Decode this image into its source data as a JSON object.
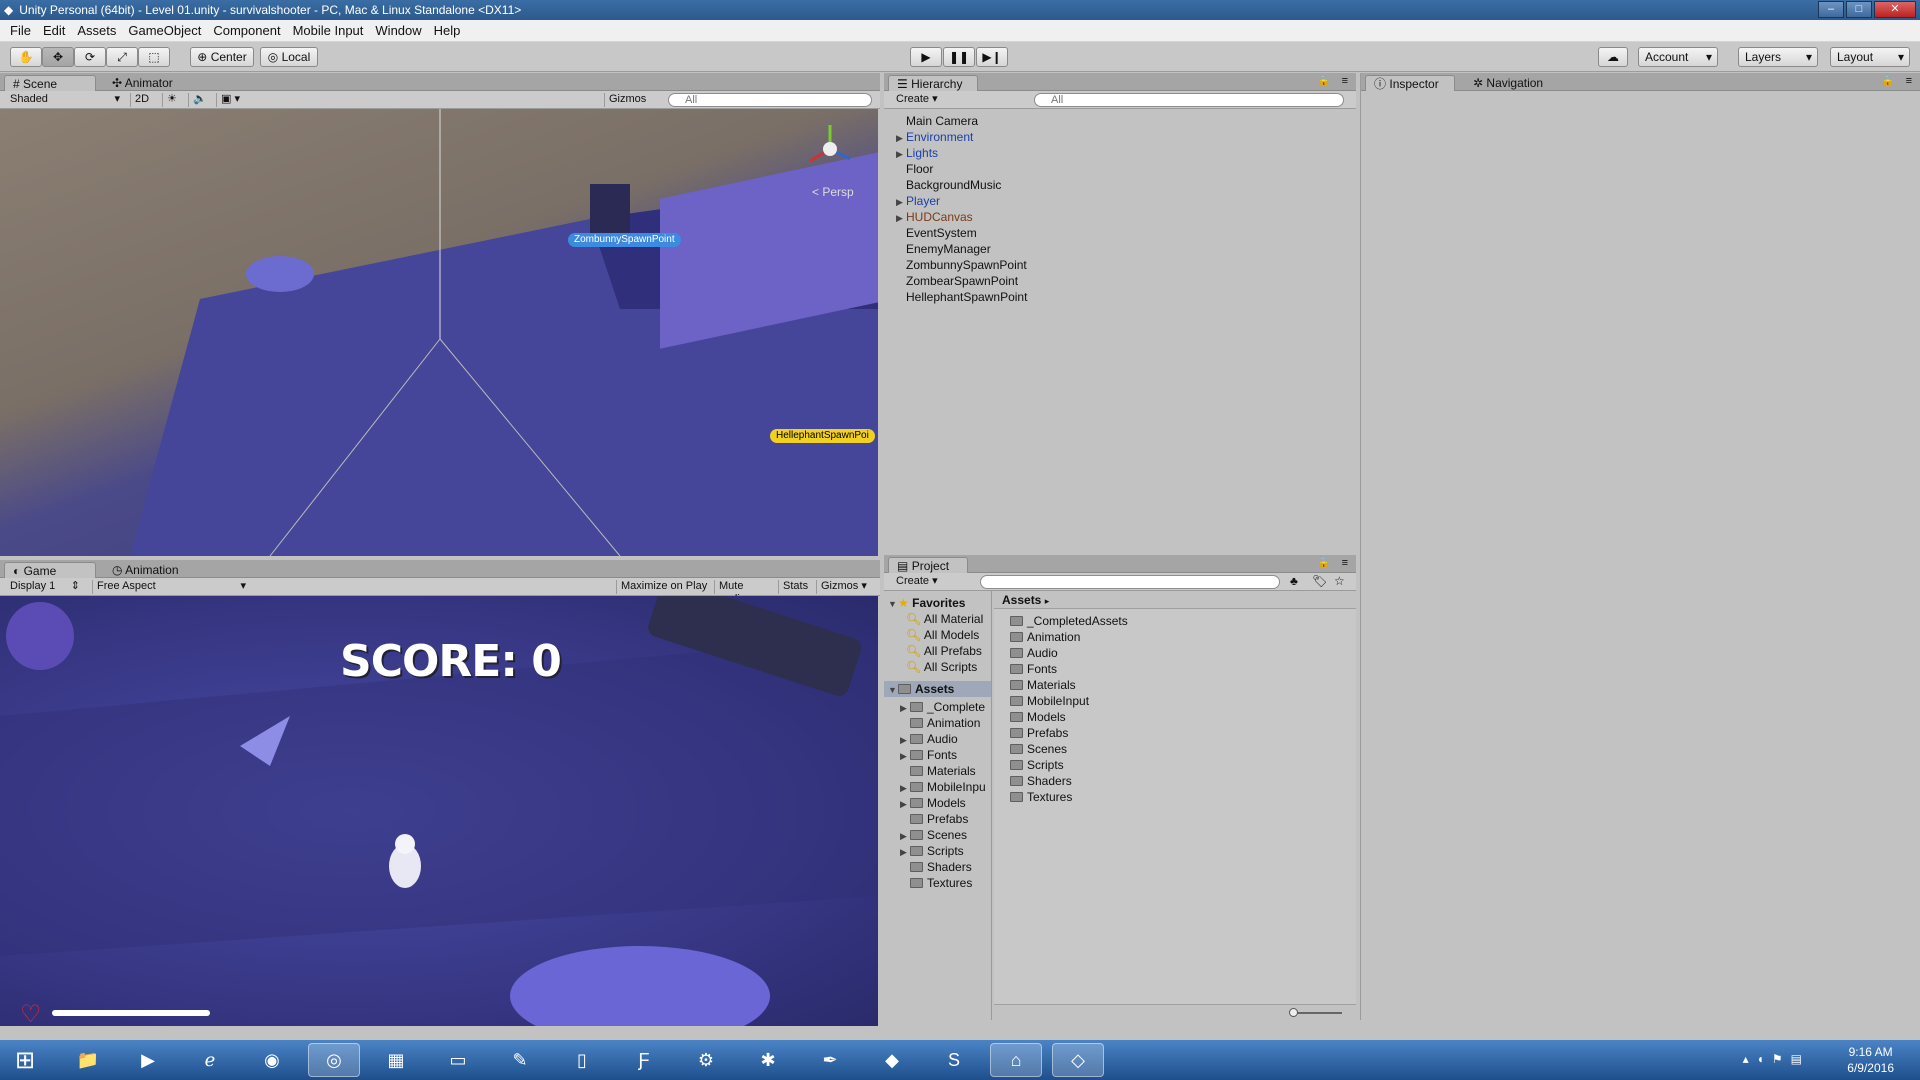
{
  "window": {
    "title": "Unity Personal (64bit) - Level 01.unity - survivalshooter - PC, Mac & Linux Standalone <DX11>"
  },
  "menu": [
    "File",
    "Edit",
    "Assets",
    "GameObject",
    "Component",
    "Mobile Input",
    "Window",
    "Help"
  ],
  "toolbar": {
    "pivot_label": "Center",
    "space_label": "Local",
    "account_label": "Account",
    "layers_label": "Layers",
    "layout_label": "Layout"
  },
  "scene": {
    "tab_label": "Scene",
    "animator_tab": "Animator",
    "shading_mode": "Shaded",
    "mode_2d": "2D",
    "gizmos_label": "Gizmos",
    "search_placeholder": "All",
    "persp_label": "Persp",
    "spawn_label_1": "ZombunnySpawnPoint",
    "spawn_label_2": "HellephantSpawnPoi"
  },
  "game": {
    "tab_label": "Game",
    "animation_tab": "Animation",
    "display": "Display 1",
    "aspect": "Free Aspect",
    "maximize": "Maximize on Play",
    "mute": "Mute audio",
    "stats": "Stats",
    "gizmos": "Gizmos",
    "score_text": "SCORE: 0",
    "health": 1.0
  },
  "hierarchy": {
    "tab_label": "Hierarchy",
    "create_label": "Create",
    "search_placeholder": "All",
    "items": [
      {
        "label": "Main Camera",
        "expandable": false,
        "color": "default"
      },
      {
        "label": "Environment",
        "expandable": true,
        "color": "blue"
      },
      {
        "label": "Lights",
        "expandable": true,
        "color": "blue"
      },
      {
        "label": "Floor",
        "expandable": false,
        "color": "default"
      },
      {
        "label": "BackgroundMusic",
        "expandable": false,
        "color": "default"
      },
      {
        "label": "Player",
        "expandable": true,
        "color": "blue"
      },
      {
        "label": "HUDCanvas",
        "expandable": true,
        "color": "brown"
      },
      {
        "label": "EventSystem",
        "expandable": false,
        "color": "default"
      },
      {
        "label": "EnemyManager",
        "expandable": false,
        "color": "default"
      },
      {
        "label": "ZombunnySpawnPoint",
        "expandable": false,
        "color": "default"
      },
      {
        "label": "ZombearSpawnPoint",
        "expandable": false,
        "color": "default"
      },
      {
        "label": "HellephantSpawnPoint",
        "expandable": false,
        "color": "default"
      }
    ]
  },
  "project": {
    "tab_label": "Project",
    "create_label": "Create",
    "favorites_label": "Favorites",
    "favorites": [
      "All Material",
      "All Models",
      "All Prefabs",
      "All Scripts"
    ],
    "assets_label": "Assets",
    "tree": [
      {
        "label": "_Complete",
        "expandable": true
      },
      {
        "label": "Animation",
        "expandable": false
      },
      {
        "label": "Audio",
        "expandable": true
      },
      {
        "label": "Fonts",
        "expandable": true
      },
      {
        "label": "Materials",
        "expandable": false
      },
      {
        "label": "MobileInpu",
        "expandable": true
      },
      {
        "label": "Models",
        "expandable": true
      },
      {
        "label": "Prefabs",
        "expandable": false
      },
      {
        "label": "Scenes",
        "expandable": true
      },
      {
        "label": "Scripts",
        "expandable": true
      },
      {
        "label": "Shaders",
        "expandable": false
      },
      {
        "label": "Textures",
        "expandable": false
      }
    ],
    "breadcrumb": "Assets",
    "folders": [
      "_CompletedAssets",
      "Animation",
      "Audio",
      "Fonts",
      "Materials",
      "MobileInput",
      "Models",
      "Prefabs",
      "Scenes",
      "Scripts",
      "Shaders",
      "Textures"
    ]
  },
  "inspector": {
    "tab_label": "Inspector",
    "navigation_tab": "Navigation"
  },
  "taskbar": {
    "time": "9:16 AM",
    "date": "6/9/2016"
  }
}
